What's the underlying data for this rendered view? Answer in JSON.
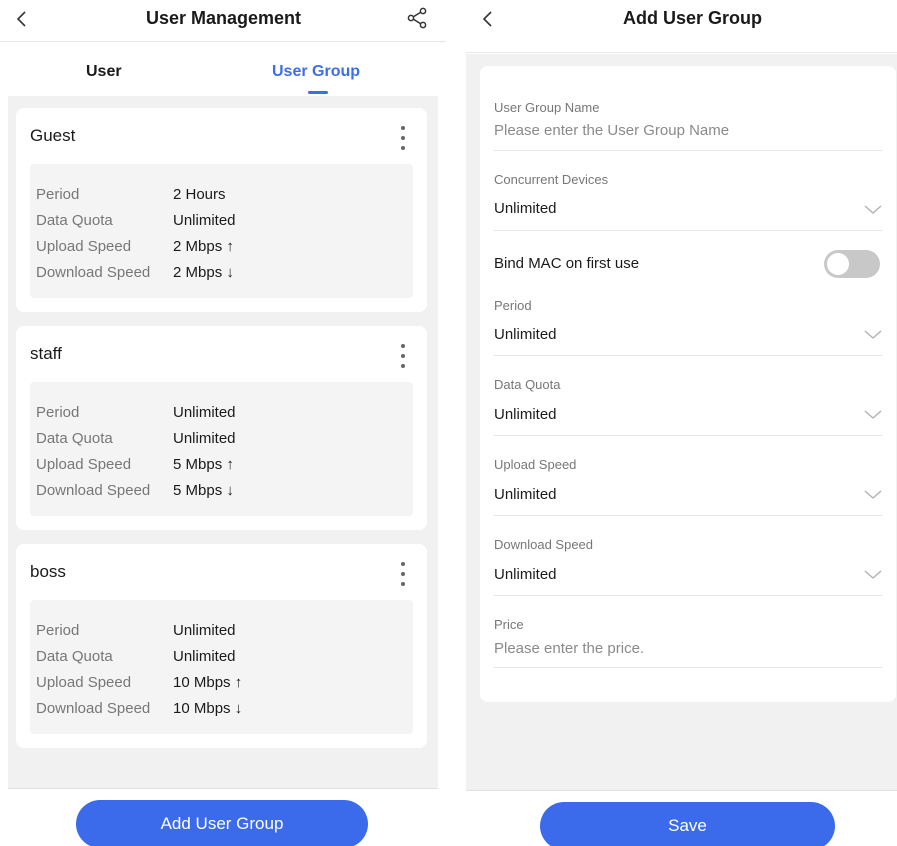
{
  "left": {
    "header": {
      "title": "User Management"
    },
    "tabs": [
      {
        "label": "User",
        "active": false
      },
      {
        "label": "User Group",
        "active": true
      }
    ],
    "groups": [
      {
        "name": "Guest",
        "details": [
          {
            "label": "Period",
            "value": "2 Hours"
          },
          {
            "label": "Data Quota",
            "value": "Unlimited"
          },
          {
            "label": "Upload Speed",
            "value": "2 Mbps ↑"
          },
          {
            "label": "Download Speed",
            "value": "2 Mbps ↓"
          }
        ]
      },
      {
        "name": "staff",
        "details": [
          {
            "label": "Period",
            "value": "Unlimited"
          },
          {
            "label": "Data Quota",
            "value": "Unlimited"
          },
          {
            "label": "Upload Speed",
            "value": "5 Mbps ↑"
          },
          {
            "label": "Download Speed",
            "value": "5 Mbps ↓"
          }
        ]
      },
      {
        "name": "boss",
        "details": [
          {
            "label": "Period",
            "value": "Unlimited"
          },
          {
            "label": "Data Quota",
            "value": "Unlimited"
          },
          {
            "label": "Upload Speed",
            "value": "10 Mbps ↑"
          },
          {
            "label": "Download Speed",
            "value": "10 Mbps ↓"
          }
        ]
      }
    ],
    "add_button_label": "Add User Group"
  },
  "right": {
    "header": {
      "title": "Add User Group"
    },
    "form": {
      "group_name": {
        "label": "User Group Name",
        "placeholder": "Please enter the User Group Name"
      },
      "concurrent_devices": {
        "label": "Concurrent Devices",
        "value": "Unlimited"
      },
      "bind_mac": {
        "label": "Bind MAC on first use",
        "enabled": false
      },
      "period": {
        "label": "Period",
        "value": "Unlimited"
      },
      "data_quota": {
        "label": "Data Quota",
        "value": "Unlimited"
      },
      "upload_speed": {
        "label": "Upload Speed",
        "value": "Unlimited"
      },
      "download_speed": {
        "label": "Download Speed",
        "value": "Unlimited"
      },
      "price": {
        "label": "Price",
        "placeholder": "Please enter the price."
      }
    },
    "save_label": "Save"
  },
  "colors": {
    "accent": "#3b6fe8",
    "button": "#3b6bea",
    "background": "#f1f1f1",
    "toggle_off": "#c8c8c8"
  },
  "icons": {
    "back": "chevron-left-icon",
    "share": "share-icon",
    "more": "kebab-icon",
    "dropdown": "chevron-down-icon"
  }
}
